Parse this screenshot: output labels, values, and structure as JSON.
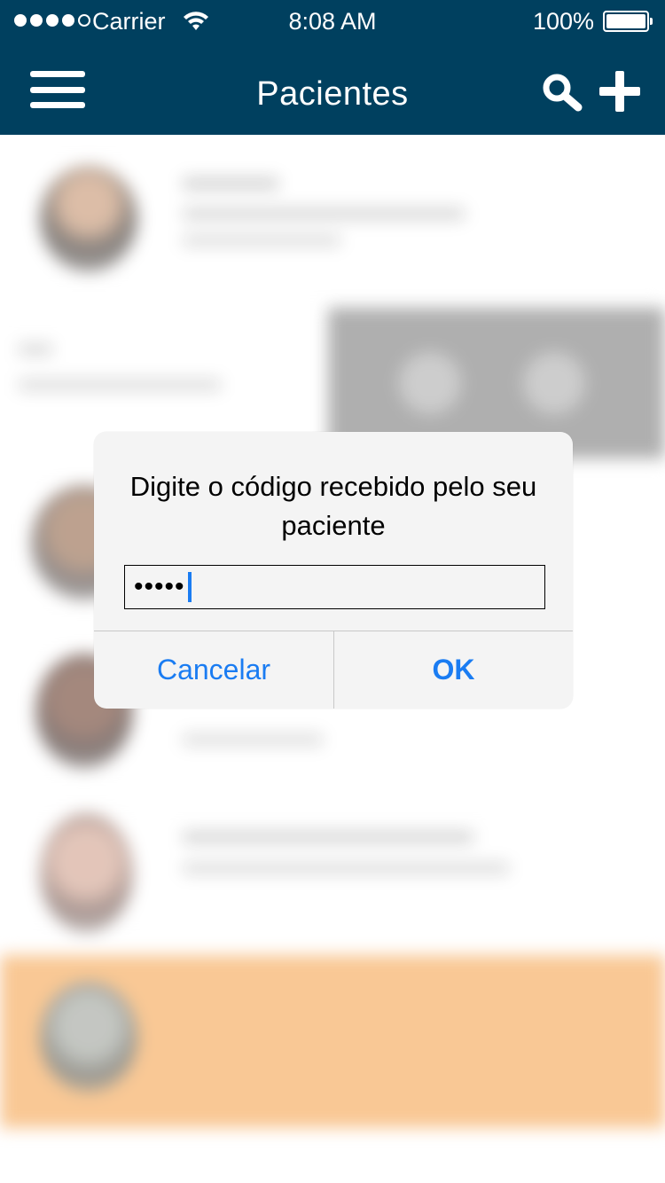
{
  "status_bar": {
    "carrier": "Carrier",
    "time": "8:08 AM",
    "battery": "100%"
  },
  "nav": {
    "title": "Pacientes",
    "menu_icon": "hamburger-menu-icon",
    "search_icon": "search-icon",
    "add_icon": "plus-icon",
    "background_color": "#00405f"
  },
  "alert": {
    "message": "Digite o código recebido pelo seu paciente",
    "input_value": "•••••",
    "cancel_label": "Cancelar",
    "ok_label": "OK",
    "accent_color": "#1a7cf2"
  },
  "list": {
    "highlight_color": "#f9c48c"
  }
}
